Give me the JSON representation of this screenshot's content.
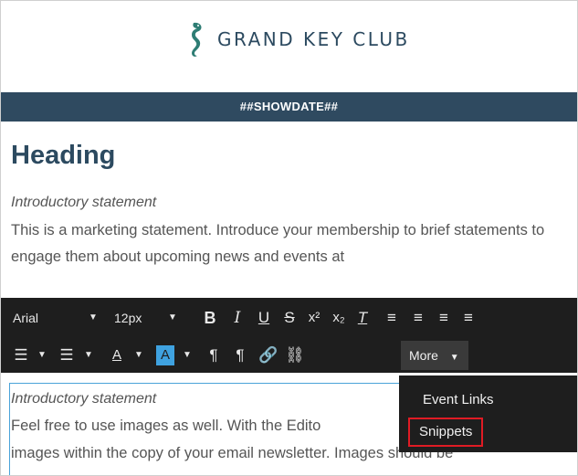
{
  "brand": {
    "logo_text": "GRAND KEY CLUB",
    "logo_icon": "seahorse-icon",
    "color": "#2c4a60"
  },
  "date_bar": {
    "text": "##SHOWDATE##"
  },
  "content": {
    "heading": "Heading",
    "intro": "Introductory statement",
    "paragraph": "This is a marketing statement. Introduce your membership to brief statements to engage them about upcoming news and events at"
  },
  "toolbar": {
    "font_family": "Arial",
    "font_size": "12px",
    "more_label": "More",
    "icons": [
      "bold-icon",
      "italic-icon",
      "underline-icon",
      "strikethrough-icon",
      "superscript-icon",
      "subscript-icon",
      "clear-format-icon",
      "align-left-icon",
      "align-center-icon",
      "align-right-icon",
      "align-justify-icon",
      "ordered-list-icon",
      "unordered-list-icon",
      "text-color-icon",
      "background-color-icon",
      "ltr-icon",
      "rtl-icon",
      "link-icon",
      "unlink-icon"
    ]
  },
  "editor": {
    "intro": "Introductory statement",
    "line1": "Feel free to use images as well. With the Edito",
    "line2": "images within the copy of your email newsletter. Images should be"
  },
  "more_menu": {
    "items": [
      "Event Links",
      "Snippets"
    ],
    "highlight": "#e01b24"
  }
}
